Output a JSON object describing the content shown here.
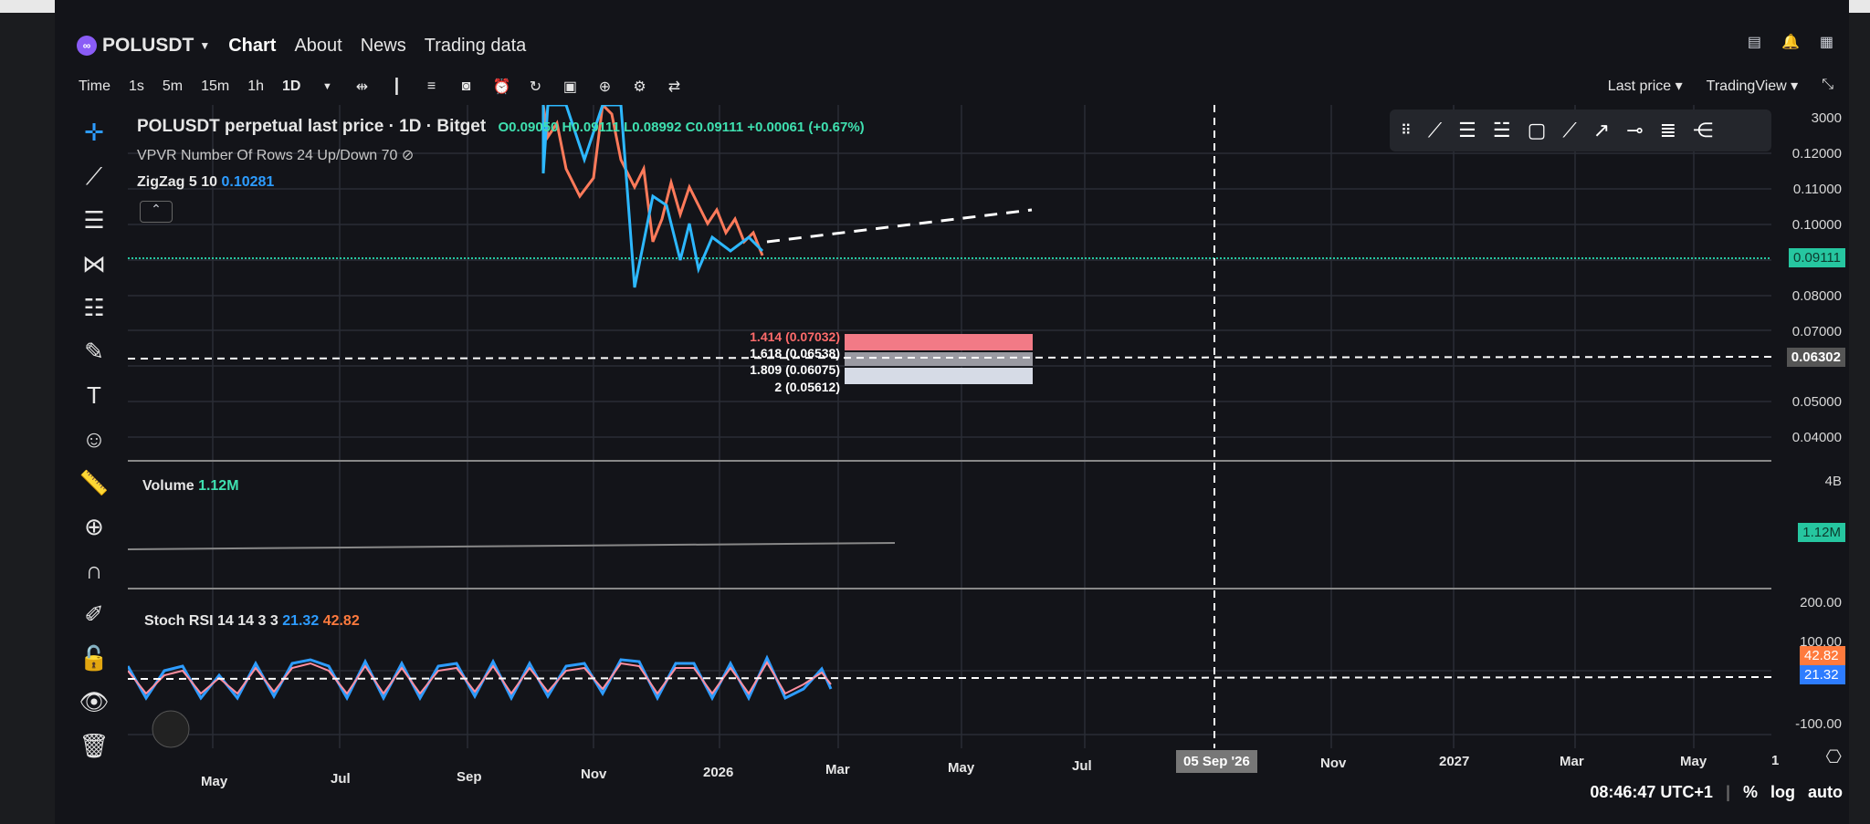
{
  "header": {
    "symbol": "POLUSDT",
    "tabs": [
      "Chart",
      "About",
      "News",
      "Trading data"
    ]
  },
  "toolbar": {
    "items": [
      "Time",
      "1s",
      "5m",
      "15m",
      "1h",
      "1D"
    ],
    "price_source": "Last price",
    "broker": "TradingView"
  },
  "legend": {
    "title": "POLUSDT perpetual last price · 1D · Bitget",
    "o": "O0.09050",
    "h": "H0.09111",
    "l": "L0.08992",
    "c": "C0.09111",
    "change": "+0.00061 (+0.67%)",
    "vpvr": "VPVR Number Of Rows 24 Up/Down 70",
    "zigzag": "ZigZag 5 10",
    "zigzag_val": "0.10281",
    "volume": "Volume",
    "volume_val": "1.12M",
    "stoch": "Stoch RSI 14 14 3 3",
    "stoch_k": "21.32",
    "stoch_d": "42.82"
  },
  "price_axis": [
    "3000",
    "0.12000",
    "0.11000",
    "0.10000",
    "0.08000",
    "0.07000",
    "0.05000",
    "0.04000"
  ],
  "last_price": "0.09111",
  "crosshair_price": "0.06302",
  "volume_axis": {
    "top": "4B",
    "current": "1.12M"
  },
  "rsi_axis": [
    "200.00",
    "100.00",
    "-100.00"
  ],
  "fib": [
    "1.414 (0.07032)",
    "1.618 (0.06538)",
    "1.809 (0.06075)",
    "2 (0.05612)"
  ],
  "time_axis": [
    "May",
    "Jul",
    "Sep",
    "Nov",
    "2026",
    "Mar",
    "May",
    "Jul",
    "Nov",
    "2027",
    "Mar",
    "May",
    "1"
  ],
  "crosshair_date": "05 Sep '26",
  "status": {
    "clock": "08:46:47 UTC+1",
    "percent": "%",
    "log": "log",
    "auto": "auto"
  },
  "colors": {
    "up": "#26c6a0",
    "down": "#ef5350",
    "blue": "#2d9cff",
    "orange": "#ff7a3d"
  }
}
